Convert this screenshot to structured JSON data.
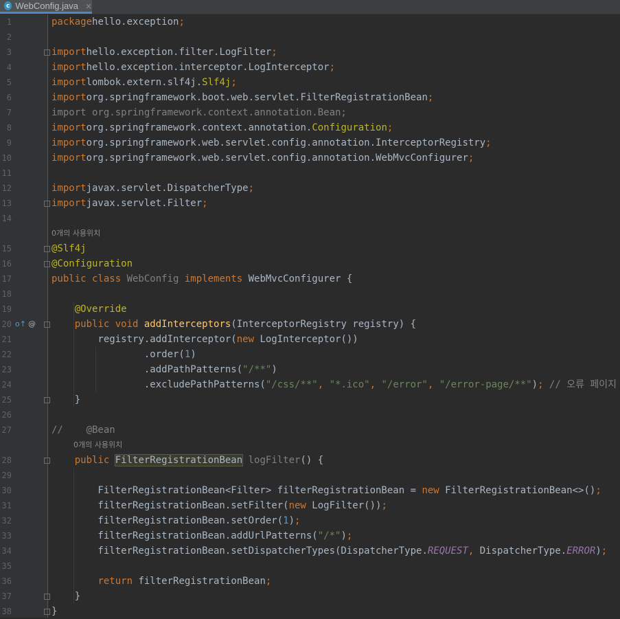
{
  "tab": {
    "label": "WebConfig.java",
    "icon_letter": "c",
    "close": "×"
  },
  "lines": [
    {
      "n": "1",
      "parts": [
        [
          "kw",
          "package"
        ],
        [
          "",
          "hello.exception"
        ],
        [
          "kw",
          ";"
        ]
      ]
    },
    {
      "n": "2",
      "parts": []
    },
    {
      "n": "3",
      "parts": [
        [
          "kw",
          "import"
        ],
        [
          "",
          "hello.exception.filter.LogFilter"
        ],
        [
          "kw",
          ";"
        ]
      ]
    },
    {
      "n": "4",
      "parts": [
        [
          "kw",
          "import"
        ],
        [
          "",
          "hello.exception.interceptor.LogInterceptor"
        ],
        [
          "kw",
          ";"
        ]
      ]
    },
    {
      "n": "5",
      "parts": [
        [
          "kw",
          "import"
        ],
        [
          "",
          "lombok.extern.slf4j."
        ],
        [
          "ann",
          "Slf4j"
        ],
        [
          "kw",
          ";"
        ]
      ]
    },
    {
      "n": "6",
      "parts": [
        [
          "kw",
          "import"
        ],
        [
          "",
          "org.springframework.boot.web.servlet.FilterRegistrationBean"
        ],
        [
          "kw",
          ";"
        ]
      ]
    },
    {
      "n": "7",
      "parts": [
        [
          "unused",
          "import org.springframework.context.annotation.Bean;"
        ]
      ]
    },
    {
      "n": "8",
      "parts": [
        [
          "kw",
          "import"
        ],
        [
          "",
          "org.springframework.context.annotation."
        ],
        [
          "ann",
          "Configuration"
        ],
        [
          "kw",
          ";"
        ]
      ]
    },
    {
      "n": "9",
      "parts": [
        [
          "kw",
          "import"
        ],
        [
          "",
          "org.springframework.web.servlet.config.annotation.InterceptorRegistry"
        ],
        [
          "kw",
          ";"
        ]
      ]
    },
    {
      "n": "10",
      "parts": [
        [
          "kw",
          "import"
        ],
        [
          "",
          "org.springframework.web.servlet.config.annotation.WebMvcConfigurer"
        ],
        [
          "kw",
          ";"
        ]
      ]
    },
    {
      "n": "11",
      "parts": []
    },
    {
      "n": "12",
      "parts": [
        [
          "kw",
          "import"
        ],
        [
          "",
          "javax.servlet.DispatcherType"
        ],
        [
          "kw",
          ";"
        ]
      ]
    },
    {
      "n": "13",
      "parts": [
        [
          "kw",
          "import"
        ],
        [
          "",
          "javax.servlet.Filter"
        ],
        [
          "kw",
          ";"
        ]
      ]
    },
    {
      "n": "14",
      "parts": []
    },
    {
      "n": "15",
      "parts": [
        [
          "ann",
          "@Slf4j"
        ]
      ]
    },
    {
      "n": "16",
      "parts": [
        [
          "ann",
          "@Configuration"
        ]
      ]
    },
    {
      "n": "17",
      "parts": [
        [
          "kw",
          "public class "
        ],
        [
          "unused",
          "WebConfig "
        ],
        [
          "kw",
          "implements "
        ],
        [
          "",
          "WebMvcConfigurer {"
        ]
      ]
    },
    {
      "n": "18",
      "parts": []
    },
    {
      "n": "19",
      "parts": [
        [
          "",
          "    "
        ],
        [
          "ann",
          "@Override"
        ]
      ]
    },
    {
      "n": "20",
      "parts": [
        [
          "",
          "    "
        ],
        [
          "kw",
          "public void "
        ],
        [
          "fn",
          "addInterceptors"
        ],
        [
          "",
          "(InterceptorRegistry registry) {"
        ]
      ]
    },
    {
      "n": "21",
      "parts": [
        [
          "",
          "        registry.addInterceptor("
        ],
        [
          "kw",
          "new "
        ],
        [
          "",
          "LogInterceptor())"
        ]
      ]
    },
    {
      "n": "22",
      "parts": [
        [
          "",
          "                .order("
        ],
        [
          "num",
          "1"
        ],
        [
          "",
          ")"
        ]
      ]
    },
    {
      "n": "23",
      "parts": [
        [
          "",
          "                .addPathPatterns("
        ],
        [
          "str",
          "\"/**\""
        ],
        [
          "",
          ")"
        ]
      ]
    },
    {
      "n": "24",
      "parts": [
        [
          "",
          "                .excludePathPatterns("
        ],
        [
          "str",
          "\"/css/**\""
        ],
        [
          "kw",
          ", "
        ],
        [
          "str",
          "\"*.ico\""
        ],
        [
          "kw",
          ", "
        ],
        [
          "str",
          "\"/error\""
        ],
        [
          "kw",
          ", "
        ],
        [
          "str",
          "\"/error-page/**\""
        ],
        [
          "",
          ")"
        ],
        [
          "kw",
          ";"
        ],
        [
          "cm",
          " // 오류 페이지 경로"
        ]
      ]
    },
    {
      "n": "25",
      "parts": [
        [
          "",
          "    }"
        ]
      ]
    },
    {
      "n": "26",
      "parts": []
    },
    {
      "n": "27",
      "parts": [
        [
          "cm",
          "//    @Bean"
        ]
      ]
    },
    {
      "n": "28",
      "parts": [
        [
          "",
          "    "
        ],
        [
          "kw",
          "public "
        ],
        [
          "hl",
          "FilterRegistrationBean"
        ],
        [
          "",
          ""
        ],
        [
          "unused",
          " logFilter"
        ],
        [
          "",
          "() {"
        ]
      ]
    },
    {
      "n": "29",
      "parts": []
    },
    {
      "n": "30",
      "parts": [
        [
          "",
          "        FilterRegistrationBean<Filter> filterRegistrationBean = "
        ],
        [
          "kw",
          "new "
        ],
        [
          "",
          "FilterRegistrationBean<>()"
        ],
        [
          "kw",
          ";"
        ]
      ]
    },
    {
      "n": "31",
      "parts": [
        [
          "",
          "        filterRegistrationBean.setFilter("
        ],
        [
          "kw",
          "new "
        ],
        [
          "",
          "LogFilter())"
        ],
        [
          "kw",
          ";"
        ]
      ]
    },
    {
      "n": "32",
      "parts": [
        [
          "",
          "        filterRegistrationBean.setOrder("
        ],
        [
          "num",
          "1"
        ],
        [
          "",
          ")"
        ],
        [
          "kw",
          ";"
        ]
      ]
    },
    {
      "n": "33",
      "parts": [
        [
          "",
          "        filterRegistrationBean.addUrlPatterns("
        ],
        [
          "str",
          "\"/*\""
        ],
        [
          "",
          ")"
        ],
        [
          "kw",
          ";"
        ]
      ]
    },
    {
      "n": "34",
      "parts": [
        [
          "",
          "        filterRegistrationBean.setDispatcherTypes(DispatcherType."
        ],
        [
          "const",
          "REQUEST"
        ],
        [
          "kw",
          ", "
        ],
        [
          "",
          "DispatcherType."
        ],
        [
          "const",
          "ERROR"
        ],
        [
          "",
          ")"
        ],
        [
          "kw",
          ";"
        ]
      ]
    },
    {
      "n": "35",
      "parts": []
    },
    {
      "n": "36",
      "parts": [
        [
          "",
          "        "
        ],
        [
          "kw",
          "return "
        ],
        [
          "",
          "filterRegistrationBean"
        ],
        [
          "kw",
          ";"
        ]
      ]
    },
    {
      "n": "37",
      "parts": [
        [
          "",
          "    }"
        ]
      ]
    },
    {
      "n": "38",
      "parts": [
        [
          "",
          "}"
        ]
      ]
    }
  ],
  "hints": [
    {
      "text": "0개의 사용위치"
    },
    {
      "text": "0개의 사용위치"
    }
  ],
  "gutter_icons": {
    "override": "o↑",
    "annotation": "@"
  }
}
